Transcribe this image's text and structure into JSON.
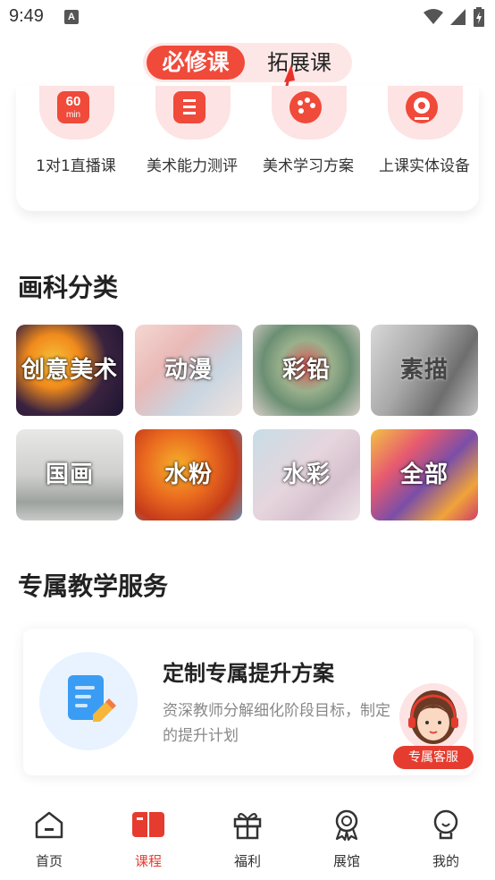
{
  "status_bar": {
    "time": "9:49",
    "notification": "A"
  },
  "tabs": {
    "required": "必修课",
    "extended": "拓展课"
  },
  "features": [
    {
      "label": "1对1直播课",
      "icon": "live-60min-icon",
      "icon_text_top": "60",
      "icon_text_bottom": "min"
    },
    {
      "label": "美术能力测评",
      "icon": "assessment-icon"
    },
    {
      "label": "美术学习方案",
      "icon": "palette-icon"
    },
    {
      "label": "上课实体设备",
      "icon": "webcam-icon"
    }
  ],
  "categories_section": {
    "title": "画科分类",
    "items": [
      {
        "label": "创意美术",
        "name": "creative-art"
      },
      {
        "label": "动漫",
        "name": "anime"
      },
      {
        "label": "彩铅",
        "name": "colored-pencil"
      },
      {
        "label": "素描",
        "name": "sketch"
      },
      {
        "label": "国画",
        "name": "chinese-painting"
      },
      {
        "label": "水粉",
        "name": "gouache"
      },
      {
        "label": "水彩",
        "name": "watercolor"
      },
      {
        "label": "全部",
        "name": "all"
      }
    ]
  },
  "service_section": {
    "title": "专属教学服务",
    "card_title": "定制专属提升方案",
    "card_desc": "资深教师分解细化阶段目标，制定的提升计划"
  },
  "support": {
    "label": "专属客服"
  },
  "bottom_nav": [
    {
      "label": "首页",
      "icon": "home-icon",
      "active": false
    },
    {
      "label": "课程",
      "icon": "course-book-icon",
      "active": true
    },
    {
      "label": "福利",
      "icon": "gift-icon",
      "active": false
    },
    {
      "label": "展馆",
      "icon": "medal-icon",
      "active": false
    },
    {
      "label": "我的",
      "icon": "profile-icon",
      "active": false
    }
  ],
  "colors": {
    "accent": "#f04a3a",
    "accent_light": "#fde3e3",
    "text": "#222222",
    "muted": "#888888"
  }
}
